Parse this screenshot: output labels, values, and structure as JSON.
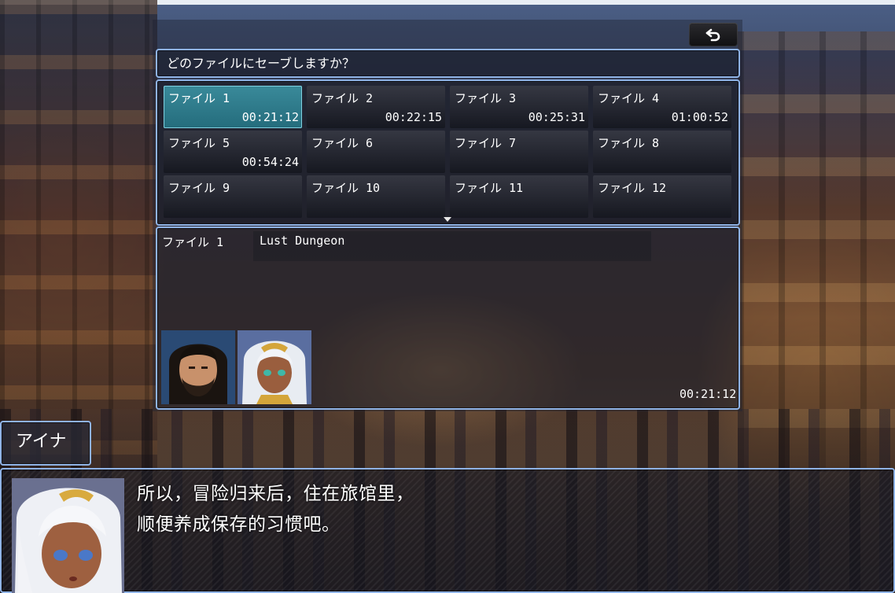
{
  "help_text": "どのファイルにセーブしますか？",
  "back_icon": "return-arrow-icon",
  "slots": [
    {
      "name": "ファイル 1",
      "time": "00:21:12",
      "selected": true
    },
    {
      "name": "ファイル 2",
      "time": "00:22:15"
    },
    {
      "name": "ファイル 3",
      "time": "00:25:31"
    },
    {
      "name": "ファイル 4",
      "time": "01:00:52"
    },
    {
      "name": "ファイル 5",
      "time": "00:54:24"
    },
    {
      "name": "ファイル 6",
      "time": ""
    },
    {
      "name": "ファイル 7",
      "time": ""
    },
    {
      "name": "ファイル 8",
      "time": ""
    },
    {
      "name": "ファイル 9",
      "time": ""
    },
    {
      "name": "ファイル 10",
      "time": ""
    },
    {
      "name": "ファイル 11",
      "time": ""
    },
    {
      "name": "ファイル 12",
      "time": ""
    }
  ],
  "status": {
    "file": "ファイル 1",
    "title": "Lust Dungeon",
    "playtime": "00:21:12"
  },
  "speaker": "アイナ",
  "message": {
    "line1": "所以，冒险归来后，住在旅馆里，",
    "line2": "顺便养成保存的习惯吧。"
  },
  "colors": {
    "window_border": "#8fb3e6",
    "selected_slot": "#2e7c8c"
  }
}
